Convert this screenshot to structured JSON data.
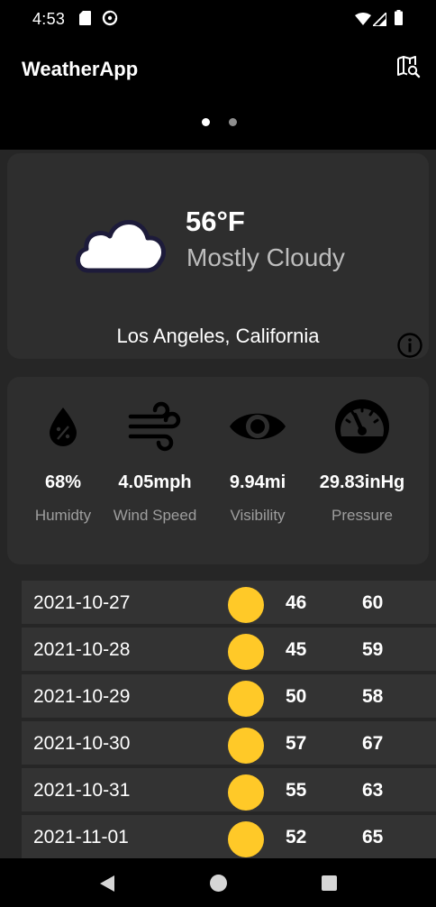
{
  "status_bar": {
    "time": "4:53",
    "icons": [
      "sd-card-icon",
      "sync-icon",
      "wifi-icon",
      "signal-icon",
      "battery-icon"
    ]
  },
  "app_bar": {
    "title": "WeatherApp",
    "action_icon": "map-search-icon",
    "pages": {
      "count": 2,
      "active": 1
    }
  },
  "current": {
    "icon": "cloud-icon",
    "temperature": "56°F",
    "condition": "Mostly Cloudy",
    "location": "Los Angeles, California",
    "info_icon": "info-icon"
  },
  "stats": [
    {
      "icon": "humidity-drop-icon",
      "value": "68%",
      "label": "Humidty"
    },
    {
      "icon": "wind-icon",
      "value": "4.05mph",
      "label": "Wind Speed"
    },
    {
      "icon": "eye-icon",
      "value": "9.94mi",
      "label": "Visibility"
    },
    {
      "icon": "gauge-icon",
      "value": "29.83inHg",
      "label": "Pressure"
    }
  ],
  "forecast": [
    {
      "date": "2021-10-27",
      "icon": "sun-icon",
      "low": "46",
      "high": "60"
    },
    {
      "date": "2021-10-28",
      "icon": "sun-icon",
      "low": "45",
      "high": "59"
    },
    {
      "date": "2021-10-29",
      "icon": "sun-icon",
      "low": "50",
      "high": "58"
    },
    {
      "date": "2021-10-30",
      "icon": "sun-icon",
      "low": "57",
      "high": "67"
    },
    {
      "date": "2021-10-31",
      "icon": "sun-icon",
      "low": "55",
      "high": "63"
    },
    {
      "date": "2021-11-01",
      "icon": "sun-icon",
      "low": "52",
      "high": "65"
    }
  ],
  "colors": {
    "background": "#262626",
    "card": "#2e2e2e",
    "row": "#333333",
    "sun": "#ffc928",
    "secondary_text": "#9e9e9e"
  },
  "nav_bar": {
    "icons": [
      "back-icon",
      "home-icon",
      "recents-icon"
    ]
  }
}
